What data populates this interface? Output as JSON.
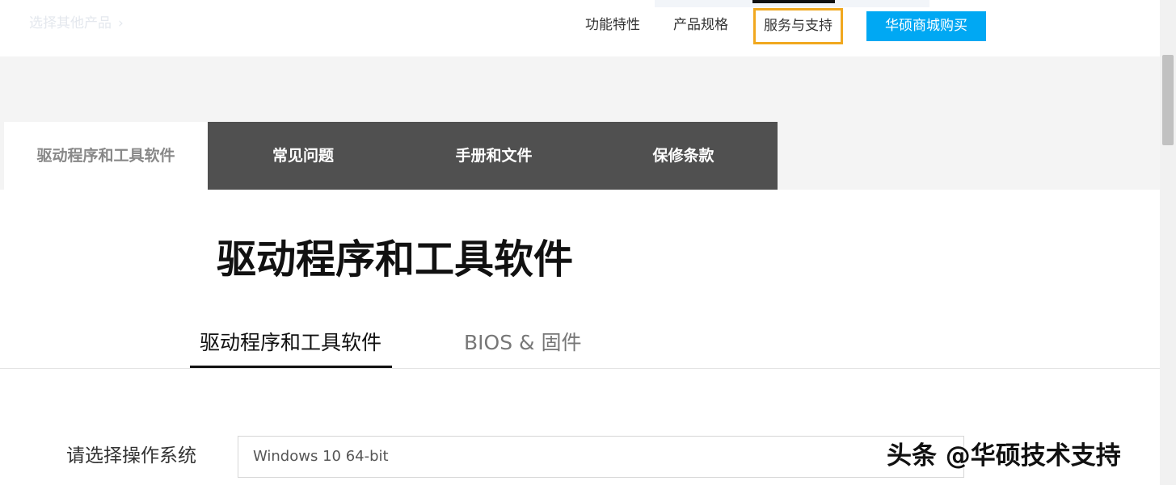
{
  "header": {
    "back_link": "选择其他产品",
    "back_chevron": "›",
    "nav": {
      "features": "功能特性",
      "specs": "产品规格",
      "support": "服务与支持"
    },
    "buy_button": "华硕商城购买"
  },
  "main_tabs": {
    "drivers": "驱动程序和工具软件",
    "faq": "常见问题",
    "manuals": "手册和文件",
    "warranty": "保修条款"
  },
  "content": {
    "title": "驱动程序和工具软件",
    "sub_tabs": {
      "drivers": "驱动程序和工具软件",
      "bios": "BIOS & 固件"
    },
    "os_label": "请选择操作系统",
    "os_selected": "Windows 10 64-bit"
  },
  "watermark": "头条 @华硕技术支持",
  "colors": {
    "accent_blue": "#00a8f3",
    "highlight_orange": "#f1a81f",
    "tab_dark": "#505050"
  }
}
